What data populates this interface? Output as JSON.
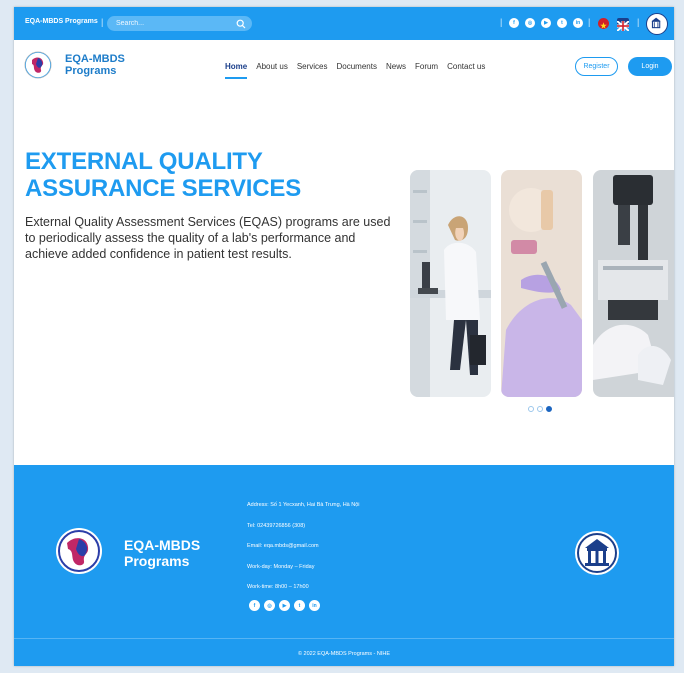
{
  "topbar": {
    "brand": "EQA-MBDS Programs",
    "search_placeholder": "Search...",
    "socials": [
      "facebook-icon",
      "instagram-icon",
      "youtube-icon",
      "twitter-icon",
      "linkedin-icon"
    ],
    "socials_glyphs": [
      "f",
      "◎",
      "▶",
      "t",
      "in"
    ],
    "languages": [
      "vietnam-flag-icon",
      "uk-flag-icon"
    ]
  },
  "header": {
    "brand_line1": "EQA-MBDS",
    "brand_line2": "Programs",
    "nav": {
      "home": "Home",
      "about": "About us",
      "services": "Services",
      "documents": "Documents",
      "news": "News",
      "forum": "Forum",
      "contact": "Contact us"
    },
    "register": "Register",
    "login": "Login"
  },
  "hero": {
    "title_line1": "EXTERNAL QUALITY",
    "title_line2": "ASSURANCE SERVICES",
    "description": "External Quality Assessment Services (EQAS) programs are used to periodically assess the quality of a lab's performance and achieve added confidence in patient test results.",
    "carousel_active": 3,
    "carousel_total": 3
  },
  "footer": {
    "brand_line1": "EQA-MBDS",
    "brand_line2": "Programs",
    "address": "Address: Số 1 Yecxanh, Hai Bà Trưng, Hà Nội",
    "tel": "Tel: 02439726856 (308)",
    "email": "Email: eqa.mbds@gmail.com",
    "workday": "Work-day: Monday – Friday",
    "worktime": "Work-time: 8h00 – 17h00",
    "copyright": "© 2022 EQA-MBDS Programs - NIHE"
  },
  "colors": {
    "primary": "#1e9bf0",
    "navy": "#1b3f8b",
    "text": "#333333"
  }
}
